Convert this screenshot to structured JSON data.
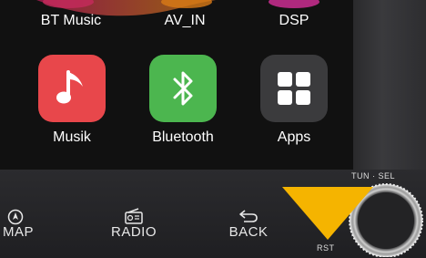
{
  "top_row": [
    {
      "label": "BT Music"
    },
    {
      "label": "AV_IN"
    },
    {
      "label": "DSP"
    }
  ],
  "apps": [
    {
      "label": "Musik",
      "icon": "music-note-icon",
      "color": "#e8474b"
    },
    {
      "label": "Bluetooth",
      "icon": "bluetooth-icon",
      "color": "#4cb64f"
    },
    {
      "label": "Apps",
      "icon": "apps-grid-icon",
      "color": "#3b3b3d"
    }
  ],
  "hardware_buttons": {
    "map": "MAP",
    "radio": "RADIO",
    "back": "BACK",
    "rst": "RST"
  },
  "knob": {
    "label": "TUN · SEL"
  },
  "colors": {
    "highlight_arrow": "#f5b400"
  }
}
